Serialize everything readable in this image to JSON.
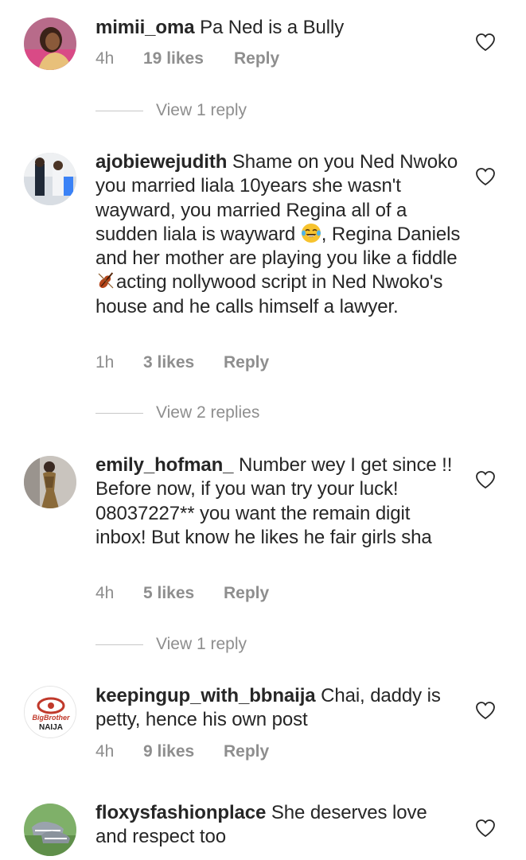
{
  "comments": [
    {
      "username": "mimii_oma",
      "text": "Pa Ned is a Bully",
      "time": "4h",
      "likes": "19 likes",
      "reply_label": "Reply",
      "view_replies": "View 1 reply"
    },
    {
      "username": "ajobiewejudith",
      "text_part1": "Shame on you Ned Nwoko you married liala 10years she wasn't wayward, you married Regina all of a sudden liala is wayward ",
      "text_part2": ", Regina Daniels and her mother are playing you like a fiddle ",
      "text_part3": "acting nollywood script in Ned Nwoko's house and he calls himself a lawyer.",
      "emoji_1": "face-with-tears-of-joy",
      "emoji_2": "violin",
      "time": "1h",
      "likes": "3 likes",
      "reply_label": "Reply",
      "view_replies": "View 2 replies"
    },
    {
      "username": "emily_hofman_",
      "text": "Number wey I get since !! Before now, if you wan try your luck! 08037227** you want the remain digit inbox! But know he likes he fair girls sha",
      "time": "4h",
      "likes": "5 likes",
      "reply_label": "Reply",
      "view_replies": "View 1 reply"
    },
    {
      "username": "keepingup_with_bbnaija",
      "text": "Chai, daddy is petty, hence his own post",
      "time": "4h",
      "likes": "9 likes",
      "reply_label": "Reply"
    },
    {
      "username": "floxysfashionplace",
      "text": "She deserves love and respect too"
    }
  ],
  "avatar_logo": {
    "line1": "BigBrother",
    "line2": "NAIJA"
  },
  "icons": {
    "like": "heart-outline-icon"
  },
  "colors": {
    "text": "#262626",
    "secondary": "#8e8e8e",
    "divider": "#c7c7c7"
  }
}
